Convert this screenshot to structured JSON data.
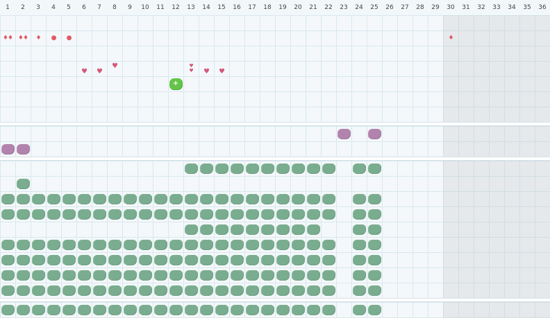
{
  "calendar": {
    "days": [
      "1",
      "2",
      "3",
      "4",
      "5",
      "6",
      "7",
      "8",
      "9",
      "10",
      "11",
      "12",
      "13",
      "14",
      "15",
      "16",
      "17",
      "18",
      "19",
      "20",
      "21",
      "22",
      "23",
      "24",
      "25",
      "26",
      "27",
      "28",
      "29",
      "30",
      "31",
      "32",
      "33",
      "34",
      "35",
      "36"
    ]
  },
  "colors": {
    "green": "#7aad8f",
    "purple": "#b283ad",
    "red": "#e05a66",
    "pink": "#d4587c",
    "bright_green": "#65c44a"
  },
  "icons": {
    "drop": "water-drop-icon",
    "dot": "dot-icon",
    "heart": "heart-icon",
    "plant": "plant-blob-icon",
    "plus": "plus-icon"
  },
  "markers": {
    "plus_symbol": "+"
  }
}
